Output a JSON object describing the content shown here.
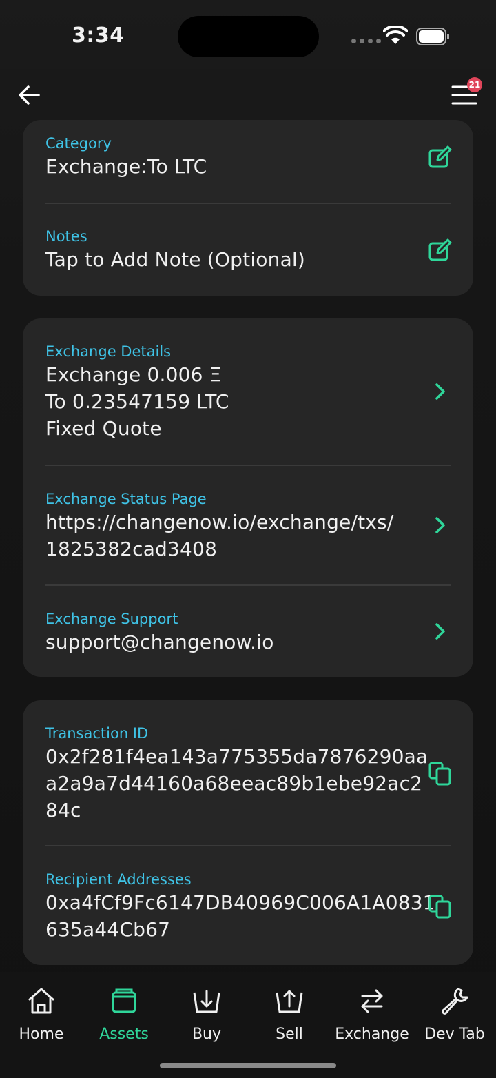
{
  "status": {
    "time": "3:34"
  },
  "nav": {
    "badge_count": "21"
  },
  "fields": {
    "category": {
      "label": "Category",
      "value": "Exchange:To LTC"
    },
    "notes": {
      "label": "Notes",
      "value": "Tap to Add Note (Optional)"
    },
    "exchange_details": {
      "label": "Exchange Details",
      "line1": "Exchange 0.006 Ξ",
      "line2": "To 0.23547159 LTC",
      "line3": "Fixed Quote"
    },
    "status_page": {
      "label": "Exchange Status Page",
      "line1": "https://changenow.io/exchange/txs/",
      "line2": "1825382cad3408"
    },
    "support": {
      "label": "Exchange Support",
      "value": "support@changenow.io"
    },
    "transaction_id": {
      "label": "Transaction ID",
      "line1": "0x2f281f4ea143a775355da7876290aa",
      "line2": "a2a9a7d44160a68eeac89b1ebe92ac2",
      "line3": "84c"
    },
    "recipient": {
      "label": "Recipient Addresses",
      "line1": "0xa4fCf9Fc6147DB40969C006A1A0831",
      "line2": "635a44Cb67"
    }
  },
  "tabs": [
    {
      "label": "Home",
      "icon": "home-icon",
      "active": false
    },
    {
      "label": "Assets",
      "icon": "wallet-icon",
      "active": true
    },
    {
      "label": "Buy",
      "icon": "buy-icon",
      "active": false
    },
    {
      "label": "Sell",
      "icon": "sell-icon",
      "active": false
    },
    {
      "label": "Exchange",
      "icon": "exchange-icon",
      "active": false
    },
    {
      "label": "Dev Tab",
      "icon": "wrench-icon",
      "active": false
    }
  ],
  "colors": {
    "accent": "#2fd69a",
    "label": "#3fc3e6",
    "card": "#262626",
    "badge": "#e0455a"
  }
}
